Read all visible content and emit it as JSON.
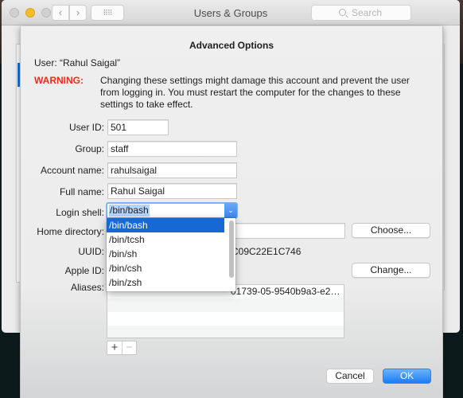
{
  "window": {
    "title": "Users & Groups",
    "search_placeholder": "Search",
    "nav_back_glyph": "‹",
    "nav_forward_glyph": "›",
    "grid_glyph": "⠿⠿"
  },
  "sheet": {
    "title": "Advanced Options",
    "user_line": "User:  “Rahul Saigal”",
    "warning_label": "WARNING:",
    "warning_text": "Changing these settings might damage this account and prevent the user from logging in. You must restart the computer for the changes to these settings to take effect.",
    "fields": {
      "user_id": {
        "label": "User ID:",
        "value": "501"
      },
      "group": {
        "label": "Group:",
        "value": "staff"
      },
      "account_name": {
        "label": "Account name:",
        "value": "rahulsaigal"
      },
      "full_name": {
        "label": "Full name:",
        "value": "Rahul Saigal"
      },
      "login_shell": {
        "label": "Login shell:",
        "value": "/bin/bash"
      },
      "home_directory": {
        "label": "Home directory:",
        "value": ""
      },
      "uuid": {
        "label": "UUID:",
        "value_visible": "C09C22E1C746"
      },
      "apple_id": {
        "label": "Apple ID:",
        "value": ""
      },
      "aliases": {
        "label": "Aliases:",
        "items_visible": [
          "01739-05-9540b9a3-e2…",
          "",
          "",
          ""
        ]
      }
    },
    "buttons": {
      "choose": "Choose...",
      "change": "Change...",
      "add": "+",
      "remove": "−",
      "cancel": "Cancel",
      "ok": "OK"
    },
    "shell_options": [
      "/bin/bash",
      "/bin/tcsh",
      "/bin/sh",
      "/bin/csh",
      "/bin/zsh"
    ],
    "shell_selected_index": 0
  },
  "colors": {
    "warning": "#f22b18",
    "accent": "#1669d5",
    "ok_button": "#1b7cf6"
  }
}
